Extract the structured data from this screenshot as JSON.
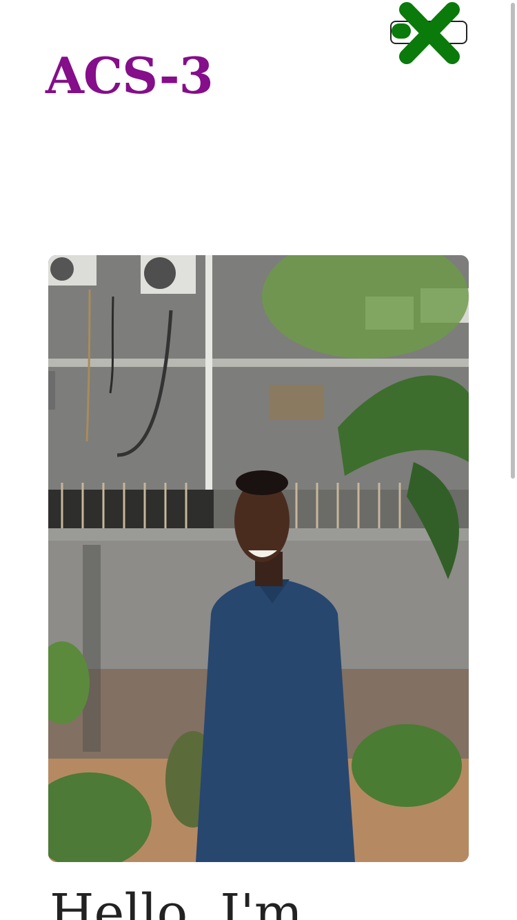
{
  "header": {
    "logo_text": "ACS-3",
    "menu_toggle": {
      "state": "open",
      "icon": "close-icon"
    }
  },
  "hero": {
    "photo": {
      "subject": "portrait-photo"
    },
    "greeting": "Hello, I'm"
  },
  "colors": {
    "logo": "#850e8a",
    "close_icon": "#0a7a0a",
    "heading_text": "#222222",
    "background": "#ffffff"
  }
}
